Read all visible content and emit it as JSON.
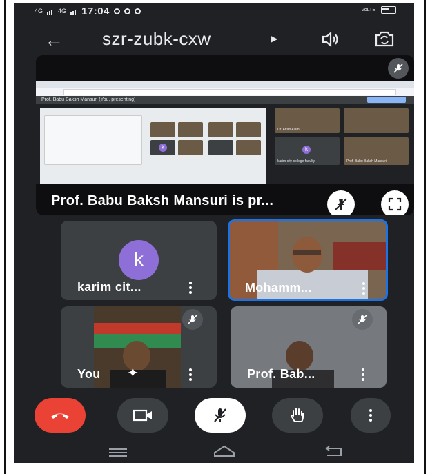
{
  "status_bar": {
    "signal_1": "4G",
    "signal_2": "4G",
    "time": "17:04",
    "volte": "VoLTE"
  },
  "top_bar": {
    "meeting_code": "szr-zubk-cxw",
    "back_icon": "arrow-left-icon",
    "caret_icon": "caret-right-icon",
    "speaker_icon": "speaker-icon",
    "switch_camera_icon": "switch-camera-icon"
  },
  "presentation": {
    "caption": "Prof. Babu Baksh Mansuri is pr...",
    "muted_icon": "mic-off-icon",
    "unpin_icon": "unpin-icon",
    "fullscreen_icon": "fullscreen-icon",
    "shared_screen": {
      "presenter_bar": "Prof. Babu Baksh Mansuri (You, presenting)",
      "stop_label": "Stop presenting",
      "tile_names": [
        "Dr. Aftab Alam",
        "karim city college faculty",
        "Prof. Babu Baksh Mansuri"
      ],
      "tile_avatar_letter": "k"
    }
  },
  "participants": [
    {
      "name": "karim cit...",
      "avatar_letter": "k",
      "avatar_color": "#8e6fd8",
      "highlighted": false
    },
    {
      "name": "Mohamm...",
      "avatar_letter": "",
      "highlighted": true
    },
    {
      "name": "You",
      "avatar_letter": "",
      "highlighted": false,
      "muted": true
    },
    {
      "name": "Prof. Bab...",
      "avatar_letter": "",
      "highlighted": false,
      "muted": true
    }
  ],
  "controls": {
    "end_call_icon": "phone-hangup-icon",
    "camera_icon": "video-camera-icon",
    "mic_icon": "mic-off-icon",
    "raise_hand_icon": "hand-icon",
    "more_icon": "more-vertical-icon"
  },
  "colors": {
    "background": "#202124",
    "tile": "#3c4043",
    "end_call": "#ea4335",
    "highlight": "#1a73e8",
    "avatar": "#8e6fd8"
  }
}
